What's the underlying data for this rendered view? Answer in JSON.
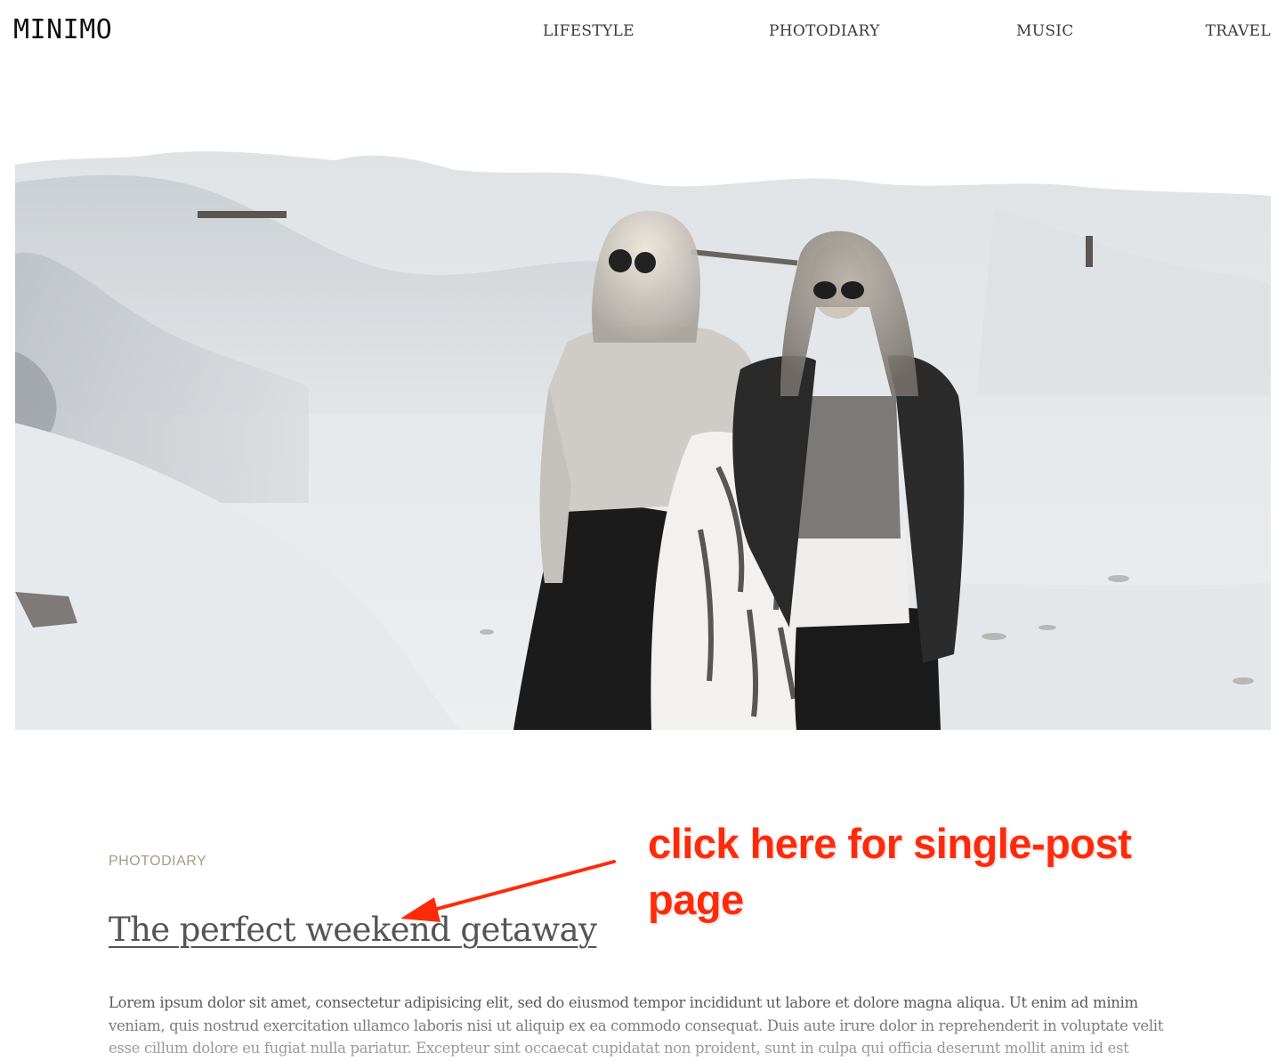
{
  "header": {
    "logo": "MINIMO",
    "nav": [
      {
        "label": "LIFESTYLE"
      },
      {
        "label": "PHOTODIARY"
      },
      {
        "label": "MUSIC"
      },
      {
        "label": "TRAVEL"
      }
    ]
  },
  "post": {
    "category": "PHOTODIARY",
    "title": "The perfect weekend getaway",
    "excerpt": "Lorem ipsum dolor sit amet, consectetur adipisicing elit, sed do eiusmod tempor incididunt ut labore et dolore magna aliqua. Ut enim ad minim veniam, quis nostrud exercitation ullamco laboris nisi ut aliquip ex ea commodo consequat. Duis aute irure dolor in reprehenderit in voluptate velit esse cillum dolore eu fugiat nulla pariatur. Excepteur sint occaecat cupidatat non proident, sunt in culpa qui officia deserunt mollit anim id est laborum."
  },
  "annotation": {
    "text": "click here for single-post page",
    "color": "#ff2a0a"
  },
  "colors": {
    "category": "#a89a86",
    "text": "#555555"
  }
}
